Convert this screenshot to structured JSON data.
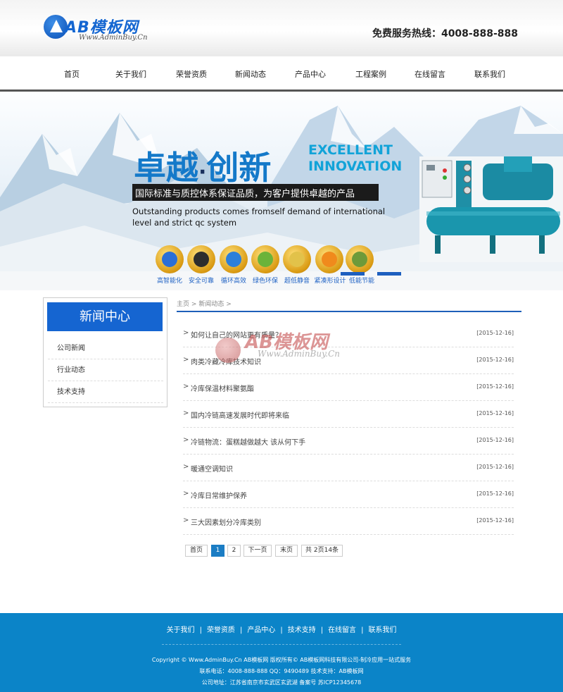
{
  "header": {
    "logo_text": "AB模板网",
    "logo_sub": "Www.AdminBuy.Cn",
    "hotline": "免费服务热线：4008-888-888"
  },
  "nav": [
    "首页",
    "关于我们",
    "荣誉资质",
    "新闻动态",
    "产品中心",
    "工程案例",
    "在线留言",
    "联系我们"
  ],
  "banner": {
    "cn1": "卓越",
    "dot": "·",
    "cn2": "创新",
    "en1": "EXCELLENT",
    "en2": "INNOVATION",
    "tagline": "国际标准与质控体系保证品质，为客户提供卓越的产品",
    "en_desc": "Outstanding products comes fromself demand of  international level and strict qc system",
    "certs": [
      "高智能化",
      "安全可靠",
      "循环高效",
      "绿色环保",
      "超低静音",
      "紧凑形设计",
      "低能节能"
    ]
  },
  "sidebar": {
    "title": "新闻中心",
    "items": [
      "公司新闻",
      "行业动态",
      "技术支持"
    ]
  },
  "breadcrumb": {
    "home": "主页",
    "sep": ">",
    "current": "新闻动态",
    "end": ">"
  },
  "news": [
    {
      "title": "如何让自己的网站更有质量？",
      "date": "[2015-12-16]"
    },
    {
      "title": "肉类冷藏冷库技术知识",
      "date": "[2015-12-16]"
    },
    {
      "title": "冷库保温材料聚氨酯",
      "date": "[2015-12-16]"
    },
    {
      "title": "国内冷链高速发展时代即将来临",
      "date": "[2015-12-16]"
    },
    {
      "title": "冷链物流：蛋糕越做越大  该从何下手",
      "date": "[2015-12-16]"
    },
    {
      "title": "暖通空调知识",
      "date": "[2015-12-16]"
    },
    {
      "title": "冷库日常维护保养",
      "date": "[2015-12-16]"
    },
    {
      "title": "三大因素划分冷库类别",
      "date": "[2015-12-16]"
    }
  ],
  "pagination": {
    "first": "首页",
    "p1": "1",
    "p2": "2",
    "next": "下一页",
    "last": "末页",
    "info": "共  2页14条"
  },
  "watermark": {
    "text": "AB模板网",
    "sub": "Www.AdminBuy.Cn"
  },
  "footer": {
    "links": [
      "关于我们",
      "荣誉资质",
      "产品中心",
      "技术支持",
      "在线留言",
      "联系我们"
    ],
    "copyright": "Copyright © Www.AdminBuy.Cn AB模板网 版权所有© AB模板网科技有限公司-制冷应用一站式服务",
    "contact": "联系电话：4008-888-888  QQ：9490489  技术支持：AB模板网",
    "address": "公司地址：江苏省南京市玄武区玄武湖  备案号  苏ICP12345678"
  },
  "colors": {
    "brand_blue": "#1565d1",
    "footer_blue": "#0b84c8",
    "accent_cyan": "#12a3d8"
  }
}
